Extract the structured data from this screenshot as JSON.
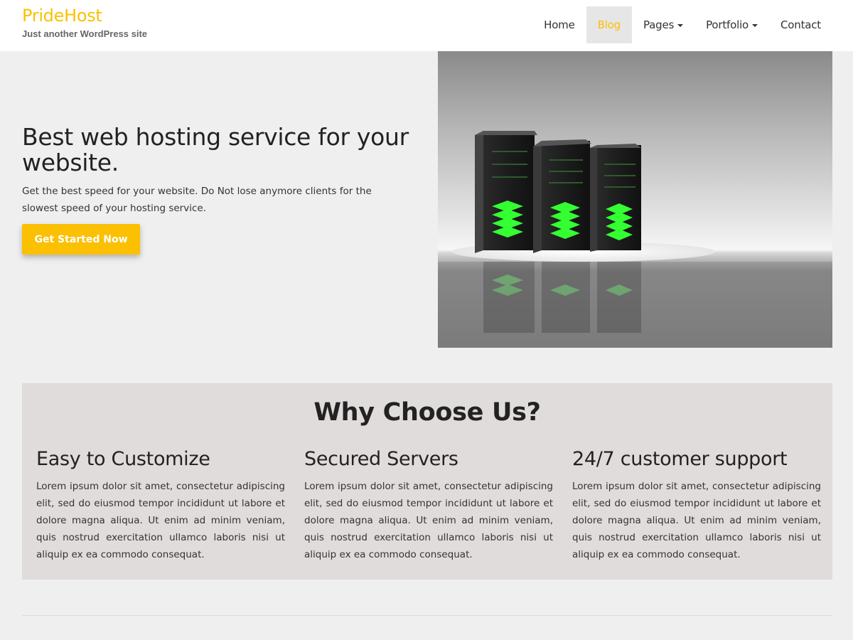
{
  "site": {
    "title": "PrideHost",
    "tagline": "Just another WordPress site",
    "brand_color": "#fbc002"
  },
  "nav": {
    "items": [
      {
        "label": "Home",
        "active": false,
        "dropdown": false
      },
      {
        "label": "Blog",
        "active": true,
        "dropdown": false
      },
      {
        "label": "Pages",
        "active": false,
        "dropdown": true
      },
      {
        "label": "Portfolio",
        "active": false,
        "dropdown": true
      },
      {
        "label": "Contact",
        "active": false,
        "dropdown": false
      }
    ]
  },
  "hero": {
    "title": "Best web hosting service for your website.",
    "description": "Get the best speed for your website. Do Not lose anymore clients for the slowest speed of your hosting service.",
    "button_label": "Get Started Now",
    "image_icon": "server-racks-image"
  },
  "why": {
    "title": "Why Choose Us?",
    "features": [
      {
        "title": "Easy to Customize",
        "text": "Lorem ipsum dolor sit amet, consectetur adipiscing elit, sed do eiusmod tempor incididunt ut labore et dolore magna aliqua. Ut enim ad minim veniam, quis nostrud exercitation ullamco laboris nisi ut aliquip ex ea commodo consequat."
      },
      {
        "title": "Secured Servers",
        "text": "Lorem ipsum dolor sit amet, consectetur adipiscing elit, sed do eiusmod tempor incididunt ut labore et dolore magna aliqua. Ut enim ad minim veniam, quis nostrud exercitation ullamco laboris nisi ut aliquip ex ea commodo consequat."
      },
      {
        "title": "24/7 customer support",
        "text": "Lorem ipsum dolor sit amet, consectetur adipiscing elit, sed do eiusmod tempor incididunt ut labore et dolore magna aliqua. Ut enim ad minim veniam, quis nostrud exercitation ullamco laboris nisi ut aliquip ex ea commodo consequat."
      }
    ]
  }
}
